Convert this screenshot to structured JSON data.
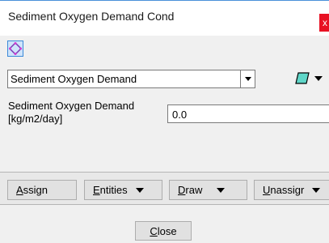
{
  "window": {
    "title": "Sediment Oxygen Demand Cond",
    "close_glyph": "x"
  },
  "toolbar": {
    "icon": "select-diamond-icon"
  },
  "condition": {
    "selected": "Sediment Oxygen Demand",
    "color_icon": "color-chip-icon"
  },
  "parameter": {
    "label_line1": "Sediment Oxygen Demand",
    "label_line2": "[kg/m2/day]",
    "value": "0.0"
  },
  "actions": {
    "assign": {
      "mnemonic": "A",
      "rest": "ssign"
    },
    "entities": {
      "mnemonic": "E",
      "rest": "ntities"
    },
    "draw": {
      "mnemonic": "D",
      "rest": "raw"
    },
    "unassign": {
      "mnemonic": "U",
      "rest": "nassigr"
    }
  },
  "footer": {
    "close": {
      "mnemonic": "C",
      "rest": "lose"
    }
  },
  "colors": {
    "accent": "#3c8ad8",
    "close_red": "#e81123",
    "panel": "#f0f0f0"
  }
}
